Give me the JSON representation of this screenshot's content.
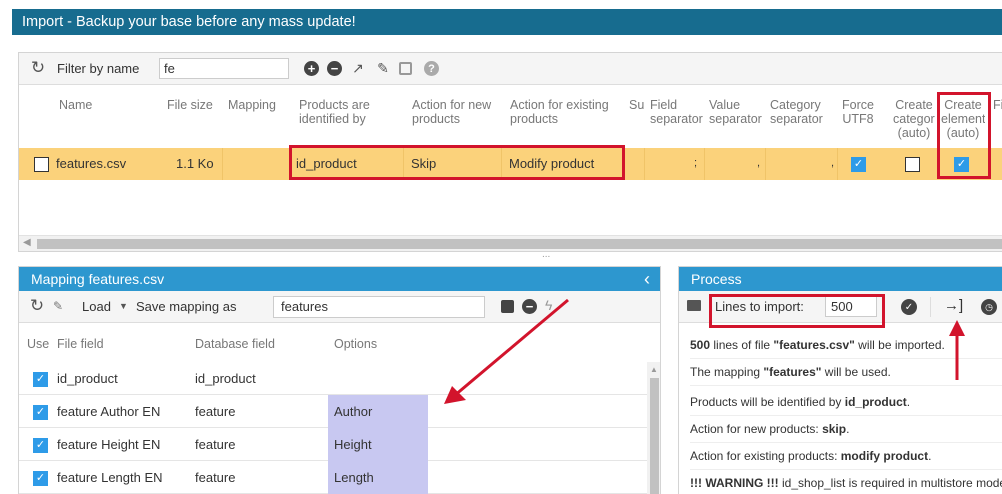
{
  "title": "Import - Backup your base before any mass update!",
  "toolbar": {
    "filter_label": "Filter by name",
    "filter_value": "fe"
  },
  "grid": {
    "headers": {
      "name": "Name",
      "file_size": "File size",
      "mapping": "Mapping",
      "identified_by": [
        "Products are",
        "identified by"
      ],
      "action_new": [
        "Action for new",
        "products"
      ],
      "action_existing": [
        "Action for existing",
        "products"
      ],
      "su": "Su",
      "field_sep": [
        "Field",
        "separator"
      ],
      "value_sep": [
        "Value",
        "separator"
      ],
      "category_sep": [
        "Category",
        "separator"
      ],
      "force_utf8": [
        "Force",
        "UTF8"
      ],
      "create_category": [
        "Create",
        "category",
        "(auto)"
      ],
      "create_element": [
        "Create",
        "element",
        "(auto)"
      ],
      "fi": "Fi"
    },
    "row": {
      "name": "features.csv",
      "size": "1.1 Ko",
      "identified_by": "id_product",
      "action_new": "Skip",
      "action_existing": "Modify product",
      "field_sep": ";",
      "value_sep": ",",
      "category_sep": ","
    }
  },
  "splitter_dots": "...",
  "mapping_panel": {
    "title": "Mapping features.csv",
    "collapse_glyph": "‹",
    "load_label": "Load",
    "save_as_label": "Save mapping as",
    "save_as_value": "features",
    "headers": {
      "use": "Use",
      "file_field": "File field",
      "db_field": "Database field",
      "options": "Options"
    },
    "rows": [
      {
        "file_field": "id_product",
        "db_field": "id_product",
        "option": ""
      },
      {
        "file_field": "feature Author EN",
        "db_field": "feature",
        "option": "Author"
      },
      {
        "file_field": "feature Height EN",
        "db_field": "feature",
        "option": "Height"
      },
      {
        "file_field": "feature Length EN",
        "db_field": "feature",
        "option": "Length"
      }
    ]
  },
  "process_panel": {
    "title": "Process",
    "lines_label": "Lines to import:",
    "lines_value": "500",
    "messages": [
      {
        "bold1": "500",
        "text1": " lines of file ",
        "bold2": "\"features.csv\"",
        "text2": " will be imported."
      },
      {
        "bold1": "",
        "text1": "The mapping ",
        "bold2": "\"features\"",
        "text2": " will be used."
      },
      {
        "bold1": "",
        "text1": "Products will be identified by ",
        "bold2": "id_product",
        "text2": "."
      },
      {
        "bold1": "",
        "text1": "Action for new products: ",
        "bold2": "skip",
        "text2": "."
      },
      {
        "bold1": "",
        "text1": "Action for existing products: ",
        "bold2": "modify product",
        "text2": "."
      },
      {
        "bold1": "!!! WARNING !!!",
        "text1": " id_shop_list is required in multistore mode",
        "bold2": "",
        "text2": ""
      }
    ]
  },
  "colors": {
    "title_bar": "#176c8f",
    "panel_header": "#2d97cf",
    "selected_row": "#fbd27b",
    "option_cell": "#c8c8f1",
    "highlight": "#d2142c",
    "checkbox_blue": "#2e9be8"
  }
}
